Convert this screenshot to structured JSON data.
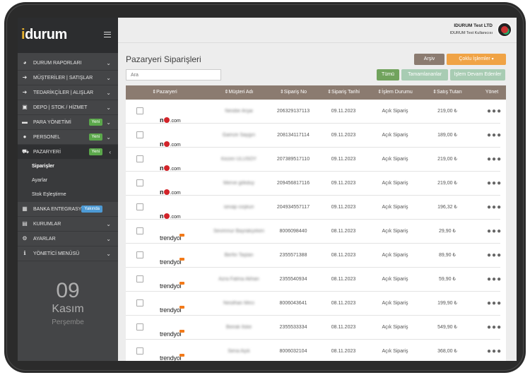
{
  "logo": {
    "brand_i": "i",
    "brand_rest": "durum"
  },
  "sidebar": {
    "items": [
      {
        "label": "DURUM RAPORLARI",
        "icon": "pie-chart-icon",
        "symbol": "◕"
      },
      {
        "label": "MÜŞTERİLER | SATIŞLAR",
        "icon": "sign-in-icon",
        "symbol": "➜"
      },
      {
        "label": "TEDARİKÇİLER | ALIŞLAR",
        "icon": "sign-out-icon",
        "symbol": "➜"
      },
      {
        "label": "DEPO | STOK / HİZMET",
        "icon": "box-icon",
        "symbol": "▣"
      },
      {
        "label": "PARA YÖNETİMİ",
        "icon": "money-icon",
        "symbol": "▬",
        "badge": "Yeni"
      },
      {
        "label": "PERSONEL",
        "icon": "users-icon",
        "symbol": "●",
        "badge": "Yeni"
      },
      {
        "label": "PAZARYERİ",
        "icon": "cart-icon",
        "symbol": "⛟",
        "badge": "Yeni"
      }
    ],
    "subitems": [
      "Siparişler",
      "Ayarlar",
      "Stok Eşleştirme"
    ],
    "items2": [
      {
        "label": "BANKA ENTEGRASYONU",
        "icon": "bank-icon",
        "symbol": "▦",
        "badge": "Yakında"
      },
      {
        "label": "KURUMLAR",
        "icon": "building-icon",
        "symbol": "▤"
      },
      {
        "label": "AYARLAR",
        "icon": "gears-icon",
        "symbol": "⚙"
      },
      {
        "label": "YÖNETİCİ MENÜSÜ",
        "icon": "info-icon",
        "symbol": "ℹ"
      }
    ],
    "date": {
      "day": "09",
      "month": "Kasım",
      "weekday": "Perşembe"
    }
  },
  "header": {
    "company": "IDURUM Test LTD",
    "user": "IDURUM Test Kullanıcısı"
  },
  "main": {
    "title": "Pazaryeri Siparişleri",
    "archive_label": "Arşiv",
    "bulk_label": "Çoklu İşlemler",
    "search_placeholder": "Ara",
    "filters": [
      "Tümü",
      "Tamamlananlar",
      "İşlem Devam Edenler"
    ]
  },
  "table": {
    "columns": [
      "Pazaryeri",
      "Müşteri Adı",
      "Sipariş No",
      "Sipariş Tarihi",
      "İşlem Durumu",
      "Satış Tutarı",
      "Yönet"
    ],
    "rows": [
      {
        "market": "n11",
        "customer": "Nesibe Arşai",
        "order_no": "206329137113",
        "date": "09.11.2023",
        "status": "Açık Sipariş",
        "amount": "219,00 ₺"
      },
      {
        "market": "n11",
        "customer": "Gamze Saygın",
        "order_no": "208134117114",
        "date": "09.11.2023",
        "status": "Açık Sipariş",
        "amount": "189,00 ₺"
      },
      {
        "market": "n11",
        "customer": "Kezim ULUSOY",
        "order_no": "207389517110",
        "date": "09.11.2023",
        "status": "Açık Sipariş",
        "amount": "219,00 ₺"
      },
      {
        "market": "n11",
        "customer": "Merve gökduy",
        "order_no": "209456817116",
        "date": "09.11.2023",
        "status": "Açık Sipariş",
        "amount": "219,00 ₺"
      },
      {
        "market": "n11",
        "customer": "sevap coşkun",
        "order_no": "204934557117",
        "date": "09.11.2023",
        "status": "Açık Sipariş",
        "amount": "196,32 ₺"
      },
      {
        "market": "trendyol",
        "customer": "Sevimnur Bayrakçeken",
        "order_no": "8006098440",
        "date": "08.11.2023",
        "status": "Açık Sipariş",
        "amount": "29,90 ₺"
      },
      {
        "market": "trendyol",
        "customer": "Berfin Taştan",
        "order_no": "2355571388",
        "date": "08.11.2023",
        "status": "Açık Sipariş",
        "amount": "89,90 ₺"
      },
      {
        "market": "trendyol",
        "customer": "Azra Fatma Akhan",
        "order_no": "2355540934",
        "date": "08.11.2023",
        "status": "Açık Sipariş",
        "amount": "59,90 ₺"
      },
      {
        "market": "trendyol",
        "customer": "Nesilhan Mirci",
        "order_no": "8006043641",
        "date": "08.11.2023",
        "status": "Açık Sipariş",
        "amount": "199,90 ₺"
      },
      {
        "market": "trendyol",
        "customer": "Beirak Ilske",
        "order_no": "2355533334",
        "date": "08.11.2023",
        "status": "Açık Sipariş",
        "amount": "549,90 ₺"
      },
      {
        "market": "trendyol",
        "customer": "Sena Aşık",
        "order_no": "8006032104",
        "date": "08.11.2023",
        "status": "Açık Sipariş",
        "amount": "368,00 ₺"
      }
    ],
    "more_symbol": "●●●",
    "n11_text": {
      "n": "n",
      "one": "1",
      "com": ".com"
    },
    "trendyol_text": "trendyol"
  },
  "colors": {
    "sidebar": "#444547",
    "table_header": "#8b7b70",
    "accent_orange": "#f0a345",
    "filter_green": "#71a35d"
  }
}
